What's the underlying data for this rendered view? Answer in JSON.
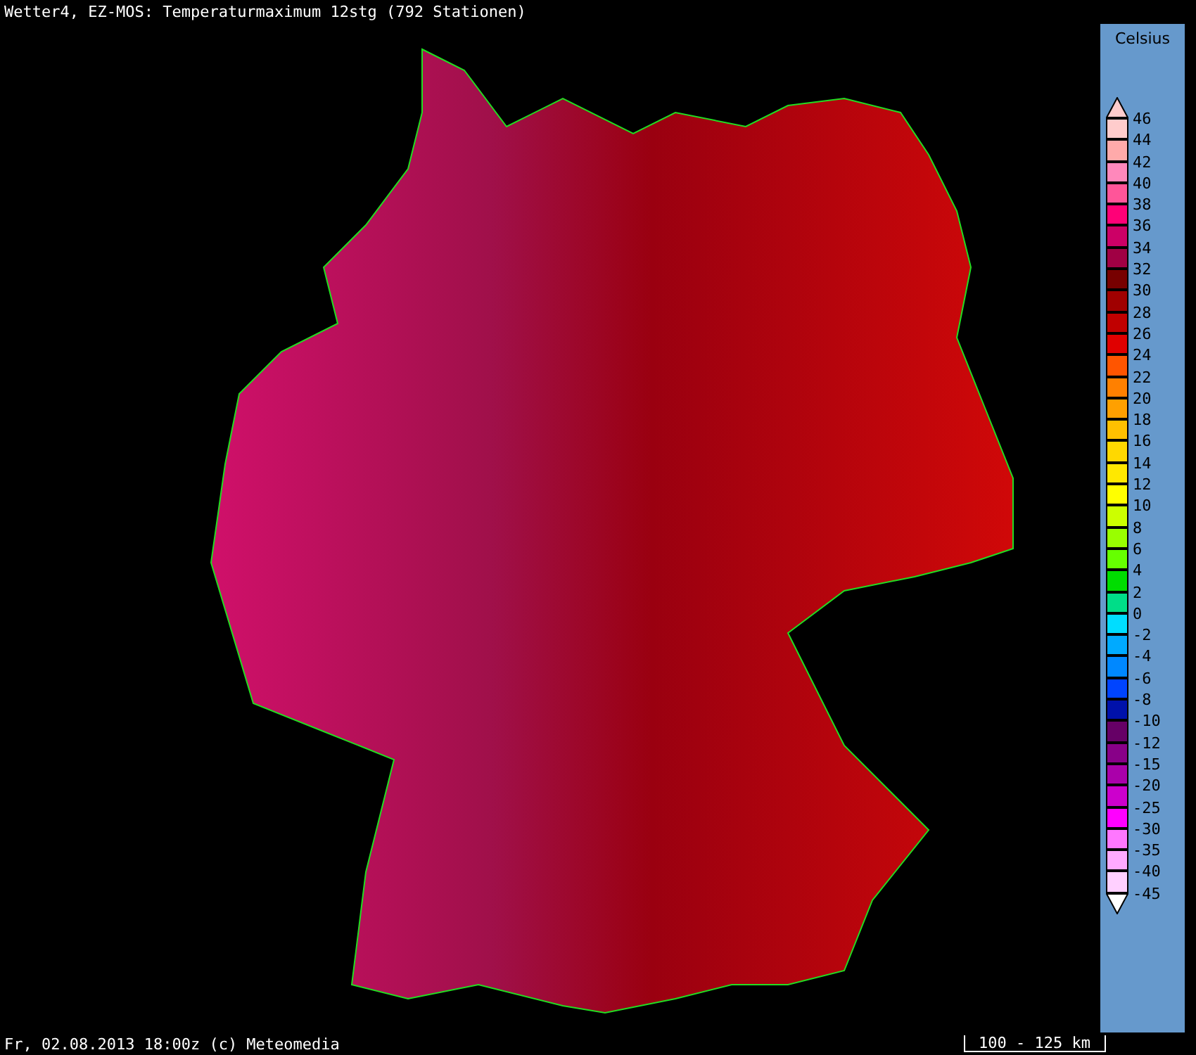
{
  "title": "Wetter4, EZ-MOS: Temperaturmaximum 12stg (792 Stationen)",
  "legend": {
    "unit": "Celsius",
    "scale": [
      {
        "label": "46",
        "color": "#ffcccc"
      },
      {
        "label": "44",
        "color": "#ffaaaa"
      },
      {
        "label": "42",
        "color": "#ff88bb"
      },
      {
        "label": "40",
        "color": "#ff5599"
      },
      {
        "label": "38",
        "color": "#ff0077"
      },
      {
        "label": "36",
        "color": "#cc0066"
      },
      {
        "label": "34",
        "color": "#a00044"
      },
      {
        "label": "32",
        "color": "#770000"
      },
      {
        "label": "30",
        "color": "#a00000"
      },
      {
        "label": "28",
        "color": "#c00000"
      },
      {
        "label": "26",
        "color": "#e00000"
      },
      {
        "label": "24",
        "color": "#ff5500"
      },
      {
        "label": "22",
        "color": "#ff8000"
      },
      {
        "label": "20",
        "color": "#ffa000"
      },
      {
        "label": "18",
        "color": "#ffc000"
      },
      {
        "label": "16",
        "color": "#ffd800"
      },
      {
        "label": "14",
        "color": "#ffe800"
      },
      {
        "label": "12",
        "color": "#ffff00"
      },
      {
        "label": "10",
        "color": "#ccff00"
      },
      {
        "label": "8",
        "color": "#99ff00"
      },
      {
        "label": "6",
        "color": "#66ff00"
      },
      {
        "label": "4",
        "color": "#00dd00"
      },
      {
        "label": "2",
        "color": "#00dd88"
      },
      {
        "label": "0",
        "color": "#00ddff"
      },
      {
        "label": "-2",
        "color": "#00aaff"
      },
      {
        "label": "-4",
        "color": "#0088ff"
      },
      {
        "label": "-6",
        "color": "#0044ff"
      },
      {
        "label": "-8",
        "color": "#0011aa"
      },
      {
        "label": "-10",
        "color": "#660066"
      },
      {
        "label": "-12",
        "color": "#880088"
      },
      {
        "label": "-15",
        "color": "#aa00aa"
      },
      {
        "label": "-20",
        "color": "#cc00cc"
      },
      {
        "label": "-25",
        "color": "#ff00ff"
      },
      {
        "label": "-30",
        "color": "#ff77ff"
      },
      {
        "label": "-35",
        "color": "#ffaaff"
      },
      {
        "label": "-40",
        "color": "#ffd0ff"
      },
      {
        "label": "-45",
        "color": "#ffffff"
      }
    ]
  },
  "footer": {
    "caption": "Fr, 02.08.2013 18:00z (c) Meteomedia",
    "scale_bar": "100 - 125 km"
  }
}
